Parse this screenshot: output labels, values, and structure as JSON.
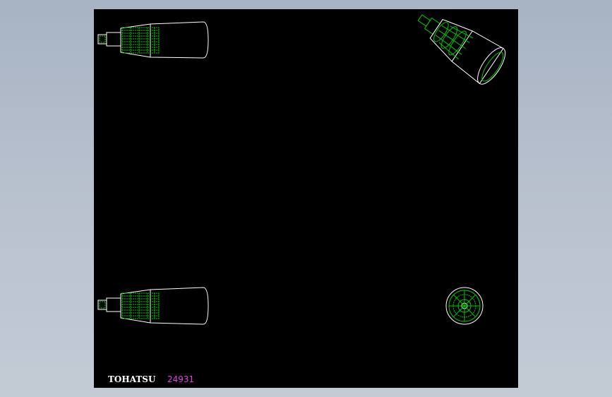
{
  "drawing": {
    "brand_text": "TOHATSU",
    "part_number": "24931",
    "colors": {
      "background": "#000000",
      "outline": "#ffffff",
      "hidden_detail": "#00c800",
      "part_number": "#e040e0"
    },
    "views": [
      {
        "name": "top-left-side-view"
      },
      {
        "name": "top-right-isometric-view"
      },
      {
        "name": "bottom-left-side-view"
      },
      {
        "name": "bottom-right-end-view"
      }
    ]
  }
}
